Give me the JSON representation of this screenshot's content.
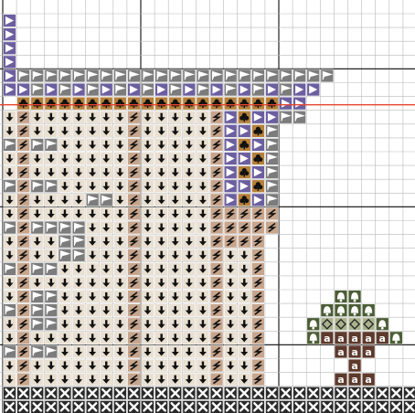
{
  "canvas": {
    "background": "#ffffff",
    "grid_color": "#b9b9b9",
    "major_grid_color": "#222222",
    "cell_stitches_visible": true
  },
  "highlight_line": {
    "color": "#e8452f",
    "visible": true
  },
  "legend": [
    {
      "symbol": "triangle",
      "color": "#6b5fa0",
      "glyph": "#ffffff",
      "name": "purple-triangle"
    },
    {
      "symbol": "flag",
      "color": "#7c7c7c",
      "glyph": "#ffffff",
      "name": "gray-flag"
    },
    {
      "symbol": "down-arrow",
      "color": "#e9e0d2",
      "glyph": "#111111",
      "name": "cream-down-arrow"
    },
    {
      "symbol": "slash",
      "color": "#c7a58c",
      "glyph": "#111111",
      "name": "tan-slash"
    },
    {
      "symbol": "club",
      "color": "#b5803a",
      "glyph": "#111111",
      "name": "ochre-club"
    },
    {
      "symbol": "bell",
      "color": "#4b5d35",
      "glyph": "#ffffff",
      "name": "green-bell"
    },
    {
      "symbol": "diamond",
      "color": "#aab28c",
      "glyph": "#222222",
      "name": "sage-diamond"
    },
    {
      "symbol": "letter-a",
      "color": "#5d3a2c",
      "glyph": "#ffffff",
      "name": "brown-a",
      "text": "a"
    },
    {
      "symbol": "x",
      "color": "#2a2a2a",
      "glyph": "#ffffff",
      "name": "charcoal-x"
    }
  ]
}
